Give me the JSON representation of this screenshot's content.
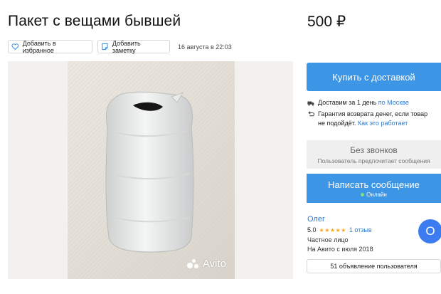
{
  "listing": {
    "title": "Пакет с вещами бывшей",
    "price": "500 ₽",
    "favorite_label": "Добавить в избранное",
    "note_label": "Добавить заметку",
    "date": "16 августа в 22:03",
    "watermark": "Avito"
  },
  "sidebar": {
    "buy_label": "Купить с доставкой",
    "delivery_text": "Доставим за 1 день",
    "delivery_link": "по Москве",
    "guarantee_text": "Гарантия возврата денег, если товар не подойдёт.",
    "guarantee_link": "Как это работает",
    "no_calls_title": "Без звонков",
    "no_calls_subtitle": "Пользователь предпочитает сообщения",
    "message_label": "Написать сообщение",
    "online_label": "Онлайн"
  },
  "seller": {
    "name": "Олег",
    "rating": "5.0",
    "stars": "★★★★★",
    "reviews": "1 отзыв",
    "type": "Частное лицо",
    "since": "На Авито с июля 2018",
    "avatar_letter": "О",
    "ads_label": "51 объявление пользователя"
  },
  "colors": {
    "accent": "#3d95e6",
    "link": "#2a7bd5",
    "star": "#f5a623",
    "online": "#7ee07a"
  },
  "icons": [
    "heart-icon",
    "note-icon",
    "truck-icon",
    "return-icon",
    "star-icon"
  ]
}
